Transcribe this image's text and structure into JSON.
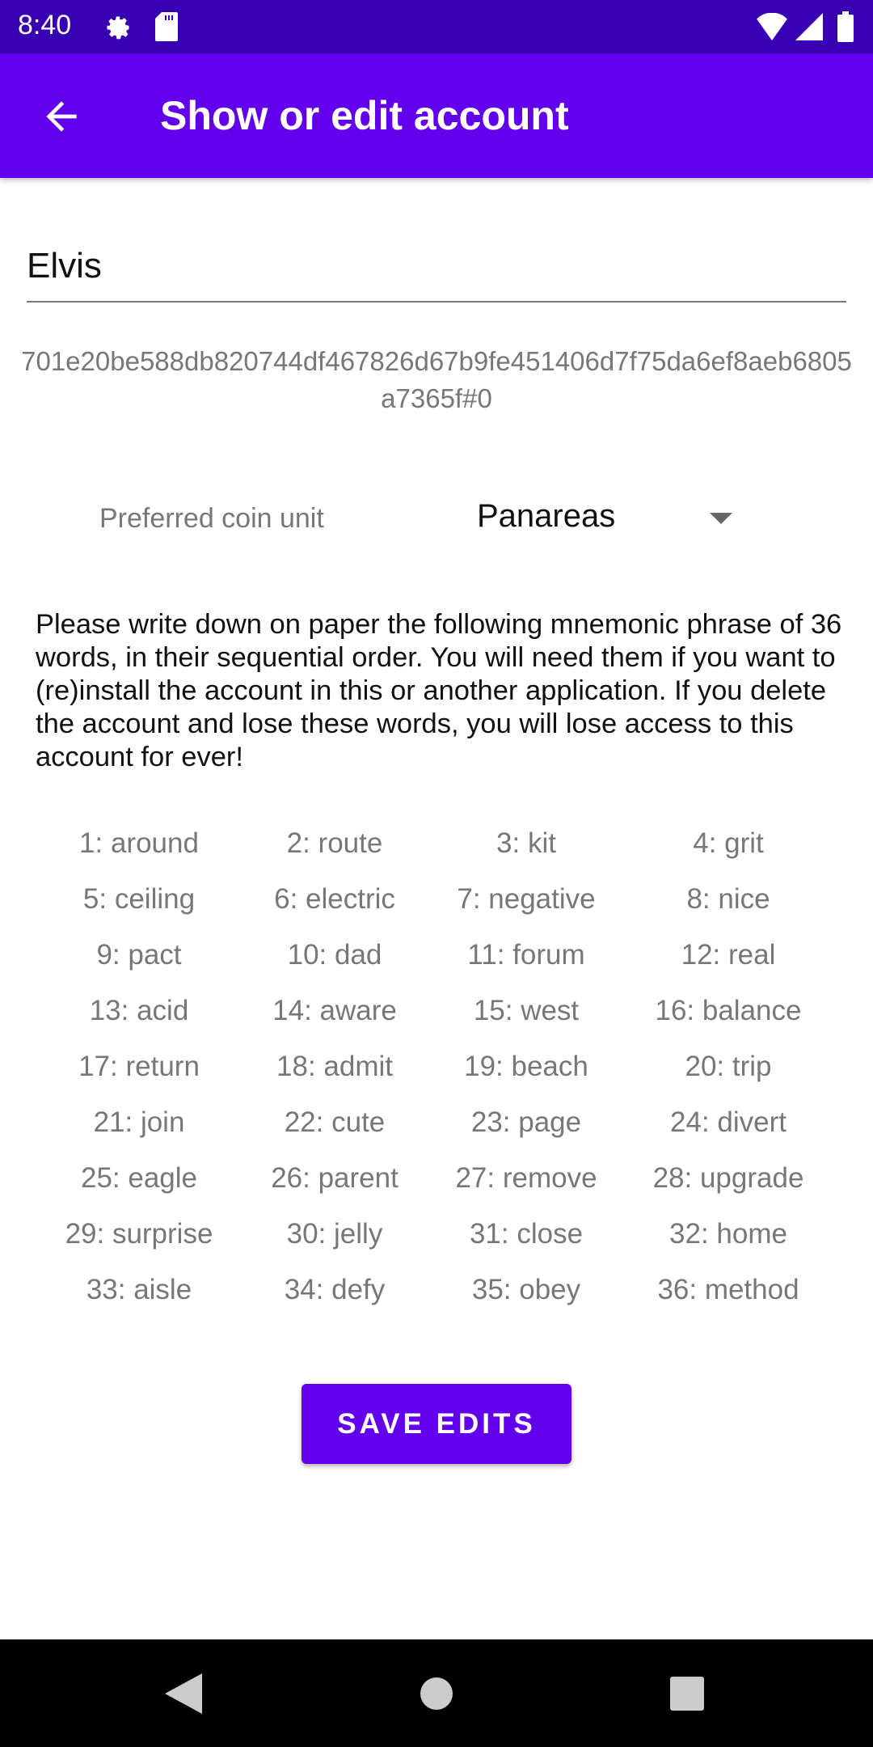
{
  "status_bar": {
    "time": "8:40",
    "icons": [
      "settings-icon",
      "sd-card-icon",
      "wifi-icon",
      "signal-icon",
      "battery-icon"
    ]
  },
  "app_bar": {
    "title": "Show or edit account",
    "back_icon": "arrow-back-icon"
  },
  "account": {
    "name": "Elvis",
    "id": "701e20be588db820744df467826d67b9fe451406d7f75da6ef8aeb6805a7365f#0"
  },
  "coin_unit": {
    "label": "Preferred coin unit",
    "value": "Panareas"
  },
  "instructions": "Please write down on paper the following mnemonic phrase of 36 words, in their sequential order. You will need them if you want to (re)install the account in this or another application. If you delete the account and lose these words, you will lose access to this account for ever!",
  "words": [
    "1: around",
    "2: route",
    "3: kit",
    "4: grit",
    "5: ceiling",
    "6: electric",
    "7: negative",
    "8: nice",
    "9: pact",
    "10: dad",
    "11: forum",
    "12: real",
    "13: acid",
    "14: aware",
    "15: west",
    "16: balance",
    "17: return",
    "18: admit",
    "19: beach",
    "20: trip",
    "21: join",
    "22: cute",
    "23: page",
    "24: divert",
    "25: eagle",
    "26: parent",
    "27: remove",
    "28: upgrade",
    "29: surprise",
    "30: jelly",
    "31: close",
    "32: home",
    "33: aisle",
    "34: defy",
    "35: obey",
    "36: method"
  ],
  "save_button": "SAVE EDITS",
  "colors": {
    "primary": "#6200EE",
    "primary_dark": "#3700B3"
  }
}
